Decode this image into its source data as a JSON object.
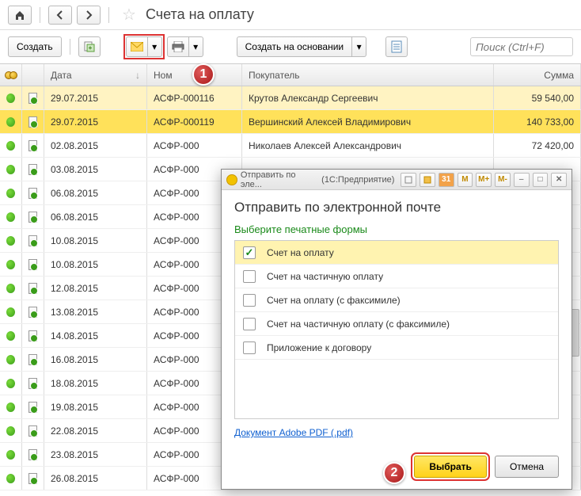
{
  "page_title": "Счета на оплату",
  "toolbar": {
    "create": "Создать",
    "based_on": "Создать на основании",
    "search_placeholder": "Поиск (Ctrl+F)"
  },
  "columns": {
    "date": "Дата",
    "number": "Ном",
    "buyer": "Покупатель",
    "sum": "Сумма"
  },
  "rows": [
    {
      "date": "29.07.2015",
      "num": "АСФР-000116",
      "buyer": "Крутов Александр Сергеевич",
      "sum": "59 540,00",
      "sel": 1
    },
    {
      "date": "29.07.2015",
      "num": "АСФР-000119",
      "buyer": "Вершинский Алексей Владимирович",
      "sum": "140 733,00",
      "sel": 2
    },
    {
      "date": "02.08.2015",
      "num": "АСФР-000",
      "buyer": "Николаев Алексей Александрович",
      "sum": "72 420,00"
    },
    {
      "date": "03.08.2015",
      "num": "АСФР-000",
      "buyer": "",
      "sum": ""
    },
    {
      "date": "06.08.2015",
      "num": "АСФР-000",
      "buyer": "",
      "sum": ""
    },
    {
      "date": "06.08.2015",
      "num": "АСФР-000",
      "buyer": "",
      "sum": ""
    },
    {
      "date": "10.08.2015",
      "num": "АСФР-000",
      "buyer": "",
      "sum": ""
    },
    {
      "date": "10.08.2015",
      "num": "АСФР-000",
      "buyer": "",
      "sum": ""
    },
    {
      "date": "12.08.2015",
      "num": "АСФР-000",
      "buyer": "",
      "sum": ""
    },
    {
      "date": "13.08.2015",
      "num": "АСФР-000",
      "buyer": "",
      "sum": ""
    },
    {
      "date": "14.08.2015",
      "num": "АСФР-000",
      "buyer": "",
      "sum": ""
    },
    {
      "date": "16.08.2015",
      "num": "АСФР-000",
      "buyer": "",
      "sum": ""
    },
    {
      "date": "18.08.2015",
      "num": "АСФР-000",
      "buyer": "",
      "sum": ""
    },
    {
      "date": "19.08.2015",
      "num": "АСФР-000",
      "buyer": "",
      "sum": ""
    },
    {
      "date": "22.08.2015",
      "num": "АСФР-000",
      "buyer": "",
      "sum": ""
    },
    {
      "date": "23.08.2015",
      "num": "АСФР-000",
      "buyer": "",
      "sum": ""
    },
    {
      "date": "26.08.2015",
      "num": "АСФР-000",
      "buyer": "",
      "sum": ""
    }
  ],
  "dialog": {
    "tab_title": "Отправить по эле...",
    "tab_app": "(1С:Предприятие)",
    "m_labels": [
      "M",
      "M+",
      "M-"
    ],
    "heading": "Отправить по электронной почте",
    "subheading": "Выберите печатные формы",
    "items": [
      {
        "label": "Счет на оплату",
        "checked": true,
        "sel": true
      },
      {
        "label": "Счет на частичную оплату",
        "checked": false
      },
      {
        "label": "Счет на оплату (с факсимиле)",
        "checked": false
      },
      {
        "label": "Счет на частичную оплату (с факсимиле)",
        "checked": false
      },
      {
        "label": "Приложение к договору",
        "checked": false
      }
    ],
    "link": "Документ Adobe PDF (.pdf)",
    "primary": "Выбрать",
    "cancel": "Отмена"
  },
  "badges": {
    "b1": "1",
    "b2": "2"
  }
}
